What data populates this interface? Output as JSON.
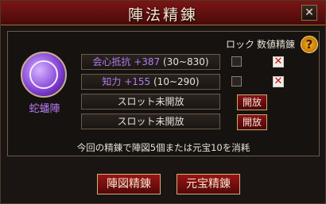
{
  "window": {
    "title": "陣法精錬",
    "close_glyph": "✕"
  },
  "headers": {
    "lock": "ロック",
    "refine": "数値精錬",
    "help_glyph": "?"
  },
  "formation": {
    "name": "蛇蟠陣",
    "icon": "serpent-emblem-icon"
  },
  "slots": [
    {
      "stat": "会心抵抗 +387",
      "range": " (30~830)",
      "locked": false,
      "refine_selected": true
    },
    {
      "stat": "知力 +155",
      "range": " (10~290)",
      "locked": false,
      "refine_selected": true
    },
    {
      "empty_label": "スロット未開放",
      "open_label": "開放"
    },
    {
      "empty_label": "スロット未開放",
      "open_label": "開放"
    }
  ],
  "cost_note": "今回の精錬で陣図5個または元宝10を消耗",
  "buttons": {
    "refine_with_scroll": "陣図精錬",
    "refine_with_ingot": "元宝精錬"
  },
  "colors": {
    "title_bar": "#7a1515",
    "stat_text": "#b47bf0",
    "accent_gold": "#d0b080"
  }
}
